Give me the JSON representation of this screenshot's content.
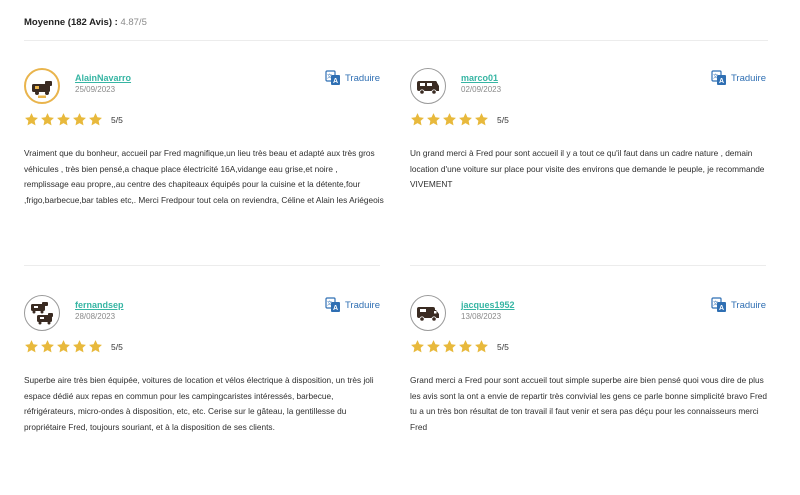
{
  "summary": {
    "label": "Moyenne (182 Avis) :",
    "score": "4.87/5"
  },
  "reviews": [
    {
      "username": "AlainNavarro",
      "date": "25/09/2023",
      "translate": "Traduire",
      "rating": "5/5",
      "stars": 5,
      "avatar_icon": "camper-trophy-icon",
      "text": "Vraiment que du bonheur, accueil par Fred magnifique,un lieu très beau et adapté aux très gros véhicules , très bien pensé,a chaque place électricité 16A,vidange eau grise,et noire , remplissage eau propre,,au centre des chapiteaux équipés pour la cuisine et la détente,four ,frigo,barbecue,bar tables etc,. Merci Fredpour tout cela on reviendra, Céline et Alain les Ariégeois"
    },
    {
      "username": "marco01",
      "date": "02/09/2023",
      "translate": "Traduire",
      "rating": "5/5",
      "stars": 5,
      "avatar_icon": "van-icon",
      "text": "Un grand merci à Fred pour sont accueil il y a tout ce qu'il faut dans un cadre nature , demain location d'une voiture sur place pour visite des environs que demande le peuple, je recommande VIVEMENT"
    },
    {
      "username": "fernandsep",
      "date": "28/08/2023",
      "translate": "Traduire",
      "rating": "5/5",
      "stars": 5,
      "avatar_icon": "campers-icon",
      "text": "Superbe aire très bien équipée, voitures de location et vélos électrique à disposition, un très joli espace dédié aux repas en commun pour les campingcaristes intéressés, barbecue, réfrigérateurs, micro-ondes à disposition, etc, etc. Cerise sur le gâteau, la gentillesse du propriétaire Fred, toujours souriant, et à la disposition de ses clients."
    },
    {
      "username": "jacques1952",
      "date": "13/08/2023",
      "translate": "Traduire",
      "rating": "5/5",
      "stars": 5,
      "avatar_icon": "camper-icon",
      "text": "Grand merci a Fred pour sont accueil tout simple superbe aire bien pensé quoi vous dire de plus les avis sont la ont a envie de repartir très convivial les gens ce parle bonne simplicité bravo Fred tu a un très bon résultat de ton travail il faut venir et sera pas déçu pour les connaisseurs merci Fred"
    }
  ],
  "colors": {
    "star": "#e8b93c",
    "username": "#36b5a3",
    "translate": "#2f6fb3",
    "avatar_gold": "#e9b44c"
  }
}
